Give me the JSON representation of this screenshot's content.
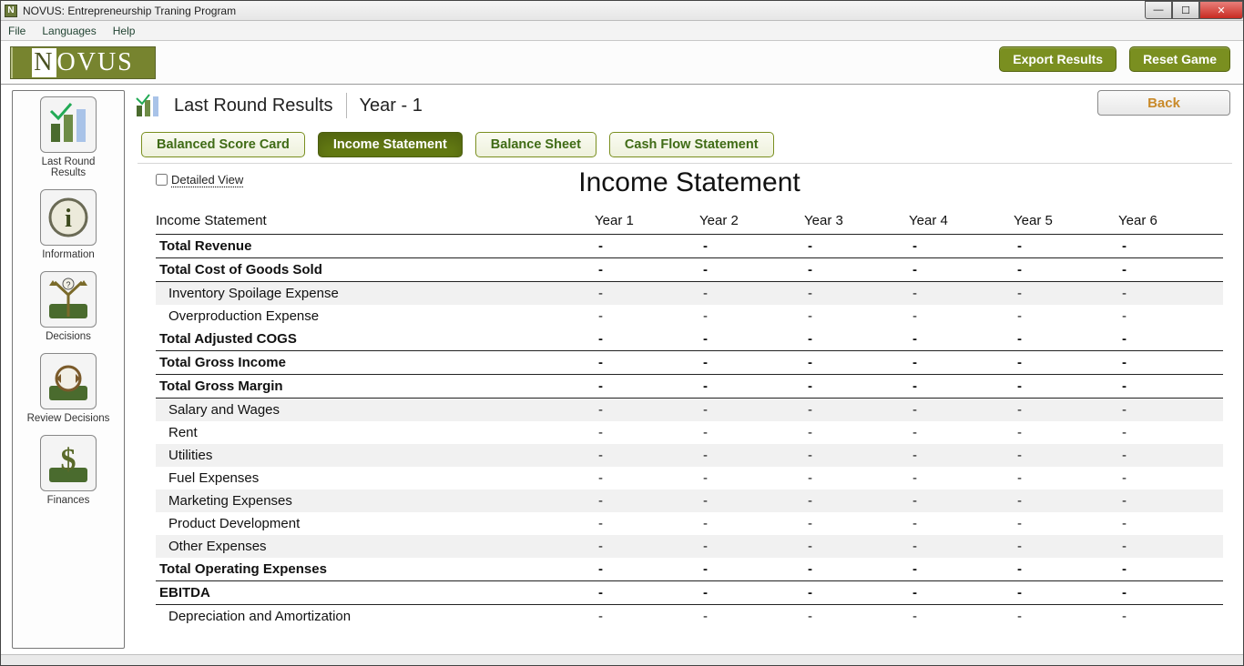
{
  "window": {
    "title": "NOVUS: Entrepreneurship Traning Program"
  },
  "menubar": {
    "file": "File",
    "languages": "Languages",
    "help": "Help"
  },
  "brand": "NOVUS",
  "top_buttons": {
    "export": "Export Results",
    "reset": "Reset Game"
  },
  "sidebar": {
    "items": [
      {
        "label": "Last Round Results"
      },
      {
        "label": "Information"
      },
      {
        "label": "Decisions"
      },
      {
        "label": "Review Decisions"
      },
      {
        "label": "Finances"
      }
    ]
  },
  "page": {
    "heading": "Last Round Results",
    "year_label": "Year - 1",
    "back": "Back"
  },
  "tabs": {
    "balanced": "Balanced Score Card",
    "income": "Income Statement",
    "balance_sheet": "Balance Sheet",
    "cash_flow": "Cash Flow Statement"
  },
  "report": {
    "detailed_label": "Detailed View",
    "title": "Income Statement",
    "row_header": "Income Statement",
    "columns": [
      "Year 1",
      "Year 2",
      "Year 3",
      "Year 4",
      "Year 5",
      "Year 6"
    ],
    "rows": [
      {
        "label": "Total Revenue",
        "style": "bold",
        "values": [
          "-",
          "-",
          "-",
          "-",
          "-",
          "-"
        ]
      },
      {
        "label": "Total Cost of Goods Sold",
        "style": "bold",
        "values": [
          "-",
          "-",
          "-",
          "-",
          "-",
          "-"
        ]
      },
      {
        "label": "Inventory Spoilage Expense",
        "style": "sub alt",
        "values": [
          "-",
          "-",
          "-",
          "-",
          "-",
          "-"
        ]
      },
      {
        "label": "Overproduction Expense",
        "style": "sub",
        "values": [
          "-",
          "-",
          "-",
          "-",
          "-",
          "-"
        ]
      },
      {
        "label": "Total Adjusted COGS",
        "style": "bold",
        "values": [
          "-",
          "-",
          "-",
          "-",
          "-",
          "-"
        ]
      },
      {
        "label": "Total Gross Income",
        "style": "bold",
        "values": [
          "-",
          "-",
          "-",
          "-",
          "-",
          "-"
        ]
      },
      {
        "label": "Total Gross Margin",
        "style": "bold",
        "values": [
          "-",
          "-",
          "-",
          "-",
          "-",
          "-"
        ]
      },
      {
        "label": "Salary and Wages",
        "style": "sub alt",
        "values": [
          "-",
          "-",
          "-",
          "-",
          "-",
          "-"
        ]
      },
      {
        "label": "Rent",
        "style": "sub",
        "values": [
          "-",
          "-",
          "-",
          "-",
          "-",
          "-"
        ]
      },
      {
        "label": "Utilities",
        "style": "sub alt",
        "values": [
          "-",
          "-",
          "-",
          "-",
          "-",
          "-"
        ]
      },
      {
        "label": "Fuel Expenses",
        "style": "sub",
        "values": [
          "-",
          "-",
          "-",
          "-",
          "-",
          "-"
        ]
      },
      {
        "label": "Marketing Expenses",
        "style": "sub alt",
        "values": [
          "-",
          "-",
          "-",
          "-",
          "-",
          "-"
        ]
      },
      {
        "label": "Product Development",
        "style": "sub",
        "values": [
          "-",
          "-",
          "-",
          "-",
          "-",
          "-"
        ]
      },
      {
        "label": "Other Expenses",
        "style": "sub alt",
        "values": [
          "-",
          "-",
          "-",
          "-",
          "-",
          "-"
        ]
      },
      {
        "label": "Total Operating Expenses",
        "style": "bold",
        "values": [
          "-",
          "-",
          "-",
          "-",
          "-",
          "-"
        ]
      },
      {
        "label": "EBITDA",
        "style": "bold",
        "values": [
          "-",
          "-",
          "-",
          "-",
          "-",
          "-"
        ]
      },
      {
        "label": "Depreciation and Amortization",
        "style": "sub",
        "values": [
          "-",
          "-",
          "-",
          "-",
          "-",
          "-"
        ]
      }
    ]
  }
}
